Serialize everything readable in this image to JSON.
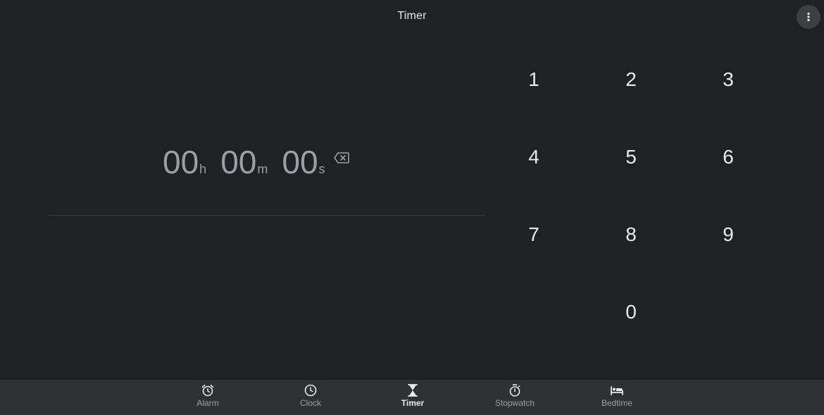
{
  "header": {
    "title": "Timer",
    "overflow_icon": "more-vert-icon"
  },
  "timer": {
    "hours": "00",
    "hours_unit": "h",
    "minutes": "00",
    "minutes_unit": "m",
    "seconds": "00",
    "seconds_unit": "s",
    "backspace_icon": "backspace-icon"
  },
  "keypad": {
    "keys": [
      "1",
      "2",
      "3",
      "4",
      "5",
      "6",
      "7",
      "8",
      "9",
      "0"
    ]
  },
  "nav": {
    "items": [
      {
        "label": "Alarm",
        "icon": "alarm-icon"
      },
      {
        "label": "Clock",
        "icon": "clock-icon"
      },
      {
        "label": "Timer",
        "icon": "hourglass-icon",
        "active": true
      },
      {
        "label": "Stopwatch",
        "icon": "stopwatch-icon"
      },
      {
        "label": "Bedtime",
        "icon": "bed-icon"
      }
    ]
  },
  "colors": {
    "background": "#202124",
    "nav_background": "#303134",
    "text_primary": "#e8eaed",
    "text_secondary": "#9aa0a6",
    "divider": "#3c4043"
  }
}
